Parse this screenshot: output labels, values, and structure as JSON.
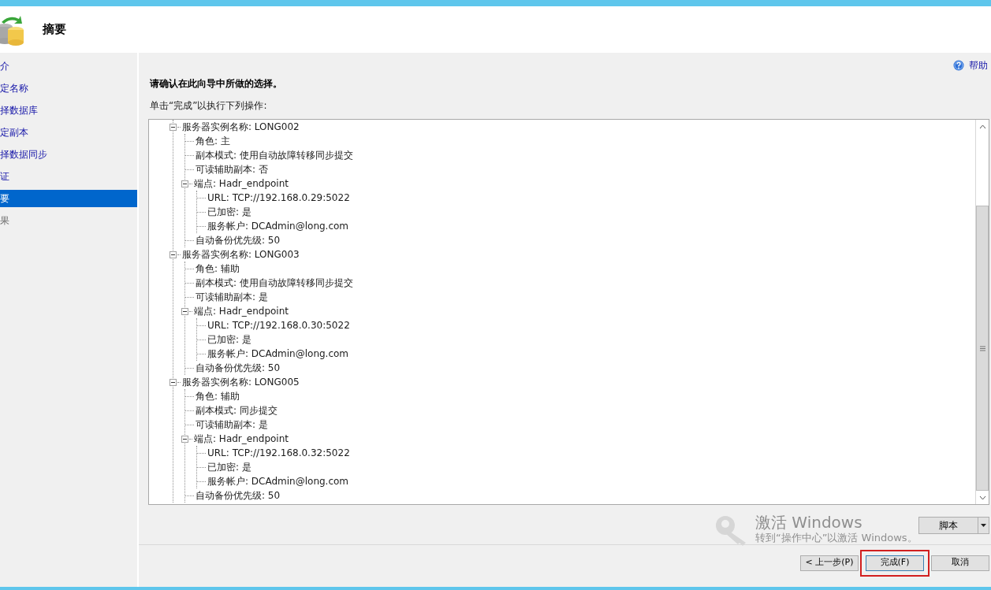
{
  "header": {
    "title": "摘要"
  },
  "sidebar": {
    "items": [
      {
        "label": "介",
        "selected": false,
        "disabled": false
      },
      {
        "label": "定名称",
        "selected": false,
        "disabled": false
      },
      {
        "label": "择数据库",
        "selected": false,
        "disabled": false
      },
      {
        "label": "定副本",
        "selected": false,
        "disabled": false
      },
      {
        "label": "择数据同步",
        "selected": false,
        "disabled": false
      },
      {
        "label": "证",
        "selected": false,
        "disabled": false
      },
      {
        "label": "要",
        "selected": true,
        "disabled": false
      },
      {
        "label": "果",
        "selected": false,
        "disabled": true
      }
    ]
  },
  "help_link": "帮助",
  "heading": "请确认在此向导中所做的选择。",
  "instruction": "单击“完成”以执行下列操作:",
  "tree": [
    {
      "label": "服务器实例名称: LONG002",
      "expanded": true,
      "children": [
        {
          "label": "角色: 主"
        },
        {
          "label": "副本模式: 使用自动故障转移同步提交"
        },
        {
          "label": "可读辅助副本: 否"
        },
        {
          "label": "端点: Hadr_endpoint",
          "expanded": true,
          "children": [
            {
              "label": "URL: TCP://192.168.0.29:5022"
            },
            {
              "label": "已加密: 是"
            },
            {
              "label": "服务帐户: DCAdmin@long.com"
            }
          ]
        },
        {
          "label": "自动备份优先级: 50"
        }
      ]
    },
    {
      "label": "服务器实例名称: LONG003",
      "expanded": true,
      "children": [
        {
          "label": "角色: 辅助"
        },
        {
          "label": "副本模式: 使用自动故障转移同步提交"
        },
        {
          "label": "可读辅助副本: 是"
        },
        {
          "label": "端点: Hadr_endpoint",
          "expanded": true,
          "children": [
            {
              "label": "URL: TCP://192.168.0.30:5022"
            },
            {
              "label": "已加密: 是"
            },
            {
              "label": "服务帐户: DCAdmin@long.com"
            }
          ]
        },
        {
          "label": "自动备份优先级: 50"
        }
      ]
    },
    {
      "label": "服务器实例名称: LONG005",
      "expanded": true,
      "children": [
        {
          "label": "角色: 辅助"
        },
        {
          "label": "副本模式: 同步提交"
        },
        {
          "label": "可读辅助副本: 是"
        },
        {
          "label": "端点: Hadr_endpoint",
          "expanded": true,
          "children": [
            {
              "label": "URL: TCP://192.168.0.32:5022"
            },
            {
              "label": "已加密: 是"
            },
            {
              "label": "服务帐户: DCAdmin@long.com"
            }
          ]
        },
        {
          "label": "自动备份优先级: 50"
        }
      ]
    }
  ],
  "script_button": "脚本",
  "activation_notice": {
    "title": "激活 Windows",
    "message": "转到“操作中心”以激活 Windows。"
  },
  "buttons": [
    {
      "label": "< 上一步(P)",
      "highlighted": false
    },
    {
      "label": "完成(F)",
      "highlighted": true
    },
    {
      "label": "取消",
      "highlighted": false
    }
  ]
}
